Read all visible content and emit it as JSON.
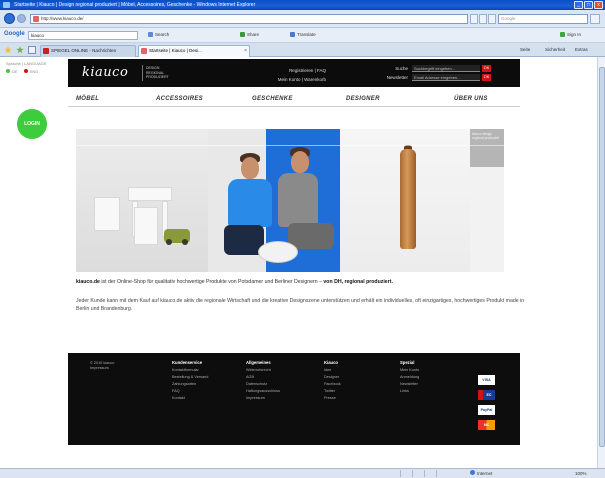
{
  "window": {
    "title": "Startseite | Kiauco | Design regional produziert | Möbel, Accessoires, Geschenke - Windows Internet Explorer",
    "min": "_",
    "max": "□",
    "close": "x"
  },
  "address": {
    "url": "http://www.kiauco.de/",
    "search_placeholder": "Google"
  },
  "toolbar": {
    "google_label": "Google",
    "google_query": "kiauco",
    "items": [
      "Search",
      "Share",
      "Translate",
      "Sign In"
    ]
  },
  "tabs": [
    {
      "label": "SPIEGEL ONLINE - Nachrichten",
      "active": false
    },
    {
      "label": "Startseite | Kiauco | Desi...",
      "active": true
    }
  ],
  "commandbar": {
    "page": "Seite",
    "safety": "Sicherheit",
    "tools": "Extras"
  },
  "site": {
    "lang": {
      "label": "Sprache | LANGUAGE",
      "options": [
        "DE",
        "ENG"
      ]
    },
    "login": "LOGIN",
    "logo": "kiauco",
    "tagline": [
      "DESIGN",
      "REGIONAL",
      "PRODUZIERT"
    ],
    "header_links": [
      "Registrieren | FAQ",
      "Mein Konto | Warenkorb"
    ],
    "search_label": "Suche",
    "search_placeholder": "Suchbegriff eingeben...",
    "newsletter_label": "Newsletter",
    "newsletter_placeholder": "Email Adresse eingeben...",
    "ok_label": "OK",
    "nav": [
      "MÖBEL",
      "ACCESSOIRES",
      "GESCHENKE",
      "DESIGNER",
      "ÜBER UNS"
    ],
    "hero_thumb_text": "kiauco design regional produziert",
    "intro_bold": "kiauco.de",
    "intro_mid": " ist der Online-Shop für qualitativ hochwertige Produkte von Potsdamer und Berliner Designern – ",
    "intro_end": "von DH, regional produziert.",
    "intro_2": "Jeder Kunde kann mit dem Kauf auf kiauco.de aktiv die regionale Wirtschaft und die kreative Designszene unterstützen und erhält ein individuelles, oft einzigartiges, hochwertiges Produkt made in Berlin und Brandenburg.",
    "footer": {
      "copyright": [
        "© 2010 kiauco",
        "Impressum"
      ],
      "columns": [
        {
          "head": "Kundenservice",
          "items": [
            "Kontaktformular",
            "Bestellung & Versand",
            "Zahlungsarten",
            "FAQ",
            "Kontakt"
          ]
        },
        {
          "head": "Allgemeines",
          "items": [
            "Widerrufsrecht",
            "AGB",
            "Datenschutz",
            "Haftungsausschluss",
            "Impressum"
          ]
        },
        {
          "head": "Kiauco",
          "items": [
            "Idee",
            "Designer",
            "Facebook",
            "Twitter",
            "Presse"
          ]
        },
        {
          "head": "Spezial",
          "items": [
            "Mein Konto",
            "Anmeldung",
            "Newsletter",
            "Links"
          ]
        }
      ],
      "payments": [
        "VISA",
        "EC",
        "PayPal",
        "MC"
      ]
    }
  },
  "status": {
    "zone": "Internet",
    "zoom": "100%"
  },
  "colors": {
    "accent_red": "#d01414",
    "login_green": "#3dcc3d",
    "hero_blue": "#1f6ed8"
  }
}
